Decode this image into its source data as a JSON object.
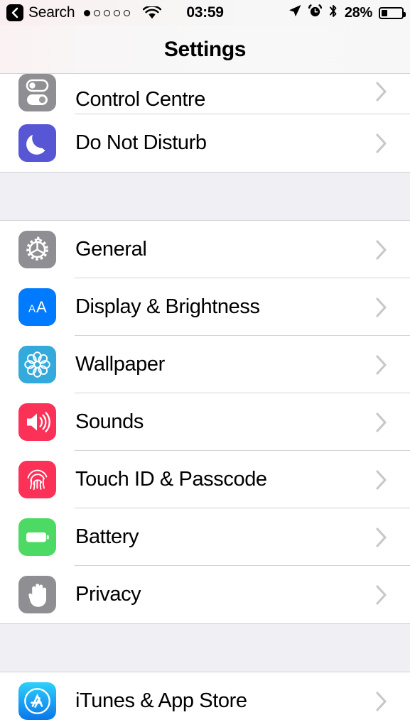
{
  "status_bar": {
    "back_label": "Search",
    "signal_dots_total": 5,
    "signal_dots_filled": 1,
    "wifi_icon": "wifi-icon",
    "time": "03:59",
    "location_icon": "location-arrow-icon",
    "alarm_icon": "alarm-clock-icon",
    "bluetooth_icon": "bluetooth-icon",
    "battery_percent": "28%",
    "battery_level": 28
  },
  "nav": {
    "title": "Settings"
  },
  "colors": {
    "gray_icon": "#8e8e93",
    "indigo": "#5756d5",
    "blue": "#007aff",
    "light_blue": "#34aadc",
    "pink": "#fc3158",
    "green": "#4cd964",
    "separator": "#d3d3d5",
    "group_gap": "#efeff4"
  },
  "groups": [
    {
      "clipped": true,
      "rows": [
        {
          "label": "Control Centre",
          "icon": "control-centre-icon",
          "icon_color": "#8e8e93",
          "clipped": true
        },
        {
          "label": "Do Not Disturb",
          "icon": "moon-icon",
          "icon_color": "#5756d5",
          "clipped": false
        }
      ]
    },
    {
      "clipped": false,
      "rows": [
        {
          "label": "General",
          "icon": "gear-icon",
          "icon_color": "#8e8e93",
          "clipped": false
        },
        {
          "label": "Display & Brightness",
          "icon": "aa-text-size-icon",
          "icon_color": "#007aff",
          "clipped": false
        },
        {
          "label": "Wallpaper",
          "icon": "flower-icon",
          "icon_color": "#34aadc",
          "clipped": false
        },
        {
          "label": "Sounds",
          "icon": "speaker-icon",
          "icon_color": "#fc3158",
          "clipped": false
        },
        {
          "label": "Touch ID & Passcode",
          "icon": "fingerprint-icon",
          "icon_color": "#fc3158",
          "clipped": false
        },
        {
          "label": "Battery",
          "icon": "battery-icon",
          "icon_color": "#4cd964",
          "clipped": false
        },
        {
          "label": "Privacy",
          "icon": "hand-icon",
          "icon_color": "#8e8e93",
          "clipped": false
        }
      ]
    },
    {
      "clipped": false,
      "rows": [
        {
          "label": "iTunes & App Store",
          "icon": "app-store-icon",
          "icon_color": "#1ab5f5",
          "clipped": false
        }
      ]
    }
  ]
}
